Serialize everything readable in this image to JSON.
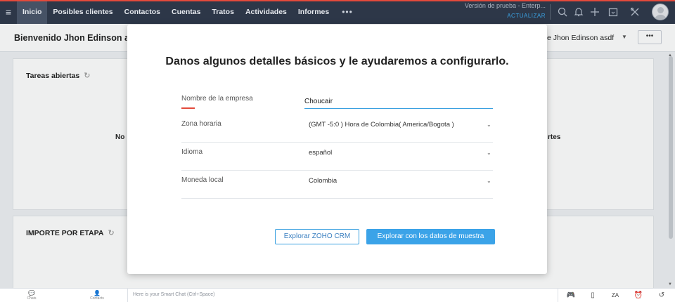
{
  "nav": {
    "items": [
      {
        "label": "Inicio",
        "active": true
      },
      {
        "label": "Posibles clientes",
        "active": false
      },
      {
        "label": "Contactos",
        "active": false
      },
      {
        "label": "Cuentas",
        "active": false
      },
      {
        "label": "Tratos",
        "active": false
      },
      {
        "label": "Actividades",
        "active": false
      },
      {
        "label": "Informes",
        "active": false
      }
    ],
    "more": "•••",
    "trial_text": "Versión de prueba - Enterp...",
    "upgrade_label": "ACTUALIZAR",
    "icons": [
      "search-icon",
      "bell-icon",
      "plus-icon",
      "calendar-icon",
      "tools-icon"
    ]
  },
  "welcome": {
    "title": "Bienvenido Jhon Edinson asd",
    "user_select": "e Jhon Edinson asdf",
    "more_button": "•••"
  },
  "panels": {
    "open_tasks_title": "Tareas abiertas",
    "open_tasks_text_left": "No",
    "open_tasks_text_right": "rtes",
    "stage_amount_title": "IMPORTE POR ETAPA"
  },
  "modal": {
    "heading": "Danos algunos detalles básicos y le ayudaremos a configurarlo.",
    "company_label": "Nombre de la empresa",
    "company_value": "Choucair",
    "timezone_label": "Zona horaria",
    "timezone_value": "(GMT -5:0 ) Hora de Colombia( America/Bogota )",
    "language_label": "Idioma",
    "language_value": "español",
    "currency_label": "Moneda local",
    "currency_value": "Colombia",
    "explore_button": "Explorar ZOHO CRM",
    "sample_button": "Explorar con los datos de muestra"
  },
  "bottom": {
    "chats_label": "Chats",
    "contacts_label": "Contacts",
    "chat_placeholder": "Here is your Smart Chat (Ctrl+Space)"
  },
  "colors": {
    "nav_bg": "#2d3748",
    "accent": "#3aa0e0",
    "primary_button": "#3ba3e8",
    "required_marker": "#e34a3b"
  }
}
